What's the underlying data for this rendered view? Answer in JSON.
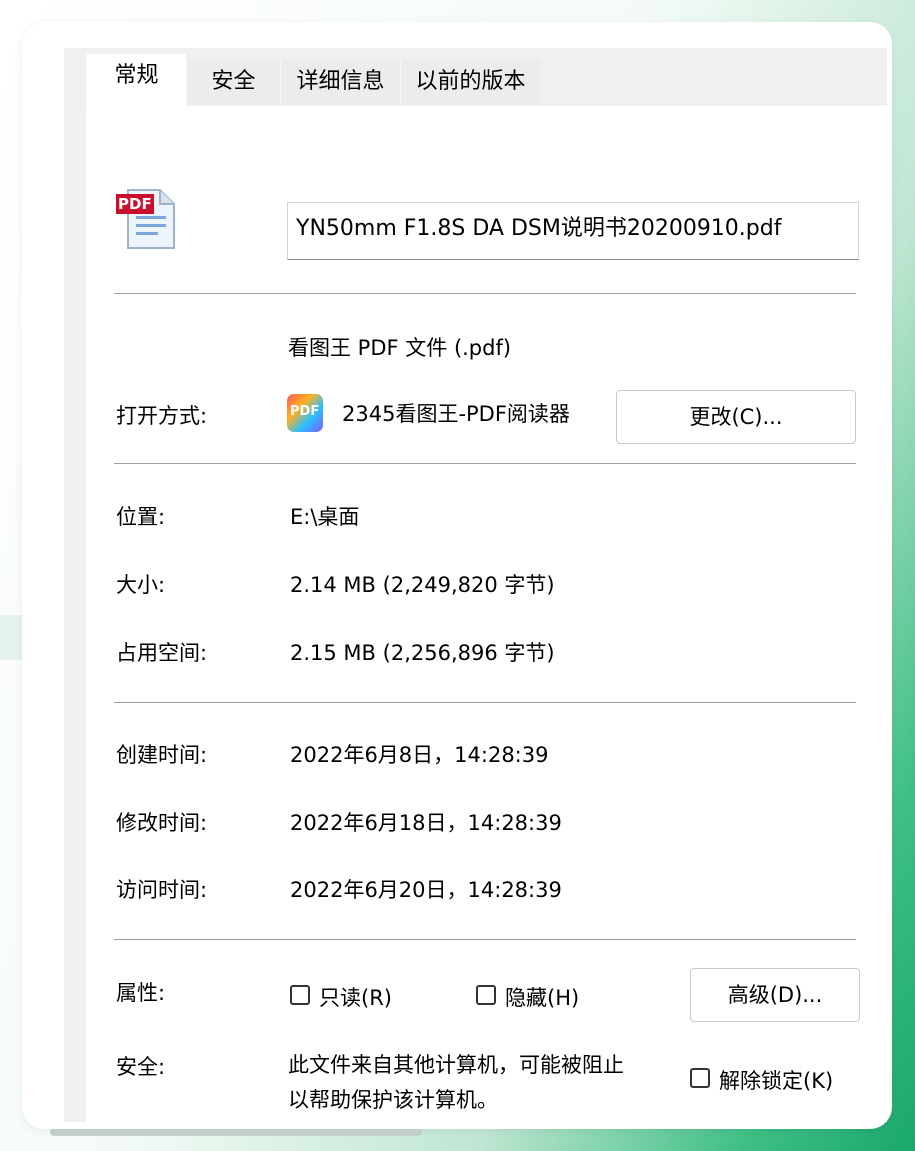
{
  "tabs": [
    "常规",
    "安全",
    "详细信息",
    "以前的版本"
  ],
  "file": {
    "name": "YN50mm F1.8S DA DSM说明书20200910.pdf",
    "icon": "pdf-file-icon",
    "icon_badge": "PDF"
  },
  "type": {
    "value": "看图王 PDF 文件 (.pdf)"
  },
  "open_with": {
    "label": "打开方式:",
    "app_name": "2345看图王-PDF阅读器",
    "app_icon_text": "PDF",
    "change_button": "更改(C)..."
  },
  "location": {
    "label": "位置:",
    "value": "E:\\桌面"
  },
  "size": {
    "label": "大小:",
    "value": "2.14 MB (2,249,820 字节)"
  },
  "size_on_disk": {
    "label": "占用空间:",
    "value": "2.15 MB (2,256,896 字节)"
  },
  "created": {
    "label": "创建时间:",
    "value": "2022年6月8日，14:28:39"
  },
  "modified": {
    "label": "修改时间:",
    "value": "2022年6月18日，14:28:39"
  },
  "accessed": {
    "label": "访问时间:",
    "value": "2022年6月20日，14:28:39"
  },
  "attributes": {
    "label": "属性:",
    "readonly": "只读(R)",
    "hidden": "隐藏(H)",
    "advanced_button": "高级(D)..."
  },
  "security": {
    "label": "安全:",
    "line1": "此文件来自其他计算机，可能被阻止",
    "line2": "以帮助保护该计算机。",
    "unblock": "解除锁定(K)"
  },
  "colors": {
    "accent_green": "#1aa86c",
    "pdf_red": "#c8102e"
  }
}
